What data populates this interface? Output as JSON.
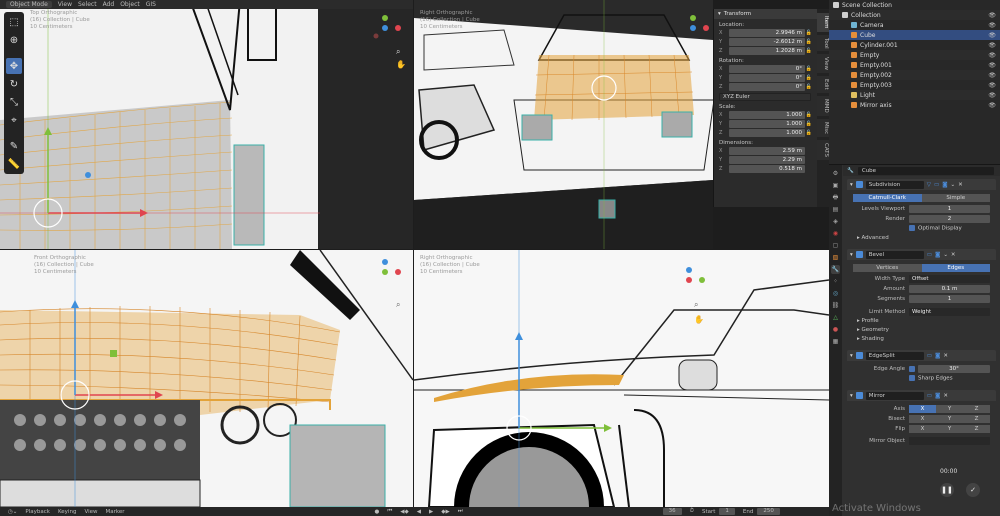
{
  "top_left": {
    "mode_label": "Object Mode",
    "menus": [
      "View",
      "Select",
      "Add",
      "Object",
      "GIS"
    ],
    "info": [
      "Top Orthographic",
      "(16) Collection | Cube",
      "10 Centimeters"
    ]
  },
  "top_right": {
    "info": [
      "Right Orthographic",
      "(16) Collection | Cube",
      "10 Centimeters"
    ]
  },
  "bottom_left": {
    "info": [
      "Front Orthographic",
      "(16) Collection | Cube",
      "10 Centimeters"
    ]
  },
  "bottom_right": {
    "info": [
      "Right Orthographic",
      "(16) Collection | Cube",
      "10 Centimeters"
    ]
  },
  "npanel": {
    "title": "Transform",
    "location_label": "Location:",
    "location": [
      {
        "axis": "X",
        "value": "2.9946 m"
      },
      {
        "axis": "Y",
        "value": "-2.6012 m"
      },
      {
        "axis": "Z",
        "value": "1.2028 m"
      }
    ],
    "rotation_label": "Rotation:",
    "rotation": [
      {
        "axis": "X",
        "value": "0°"
      },
      {
        "axis": "Y",
        "value": "0°"
      },
      {
        "axis": "Z",
        "value": "0°"
      }
    ],
    "rotation_mode": "XYZ Euler",
    "scale_label": "Scale:",
    "scale": [
      {
        "axis": "X",
        "value": "1.000"
      },
      {
        "axis": "Y",
        "value": "1.000"
      },
      {
        "axis": "Z",
        "value": "1.000"
      }
    ],
    "dimensions_label": "Dimensions:",
    "dimensions": [
      {
        "axis": "X",
        "value": "2.59 m"
      },
      {
        "axis": "Y",
        "value": "2.29 m"
      },
      {
        "axis": "Z",
        "value": "0.518 m"
      }
    ],
    "tabs": [
      "Item",
      "Tool",
      "View",
      "Edit",
      "MMD",
      "Misc",
      "CATS"
    ]
  },
  "outliner": {
    "items": [
      {
        "name": "Scene Collection",
        "indent": 0,
        "color": "#d0d0d0"
      },
      {
        "name": "Collection",
        "indent": 1,
        "color": "#d0d0d0"
      },
      {
        "name": "Camera",
        "indent": 2,
        "color": "#6fb3d2"
      },
      {
        "name": "Cube",
        "indent": 2,
        "color": "#e58e3b",
        "selected": true
      },
      {
        "name": "Cylinder.001",
        "indent": 2,
        "color": "#e58e3b"
      },
      {
        "name": "Empty",
        "indent": 2,
        "color": "#e58e3b"
      },
      {
        "name": "Empty.001",
        "indent": 2,
        "color": "#e58e3b"
      },
      {
        "name": "Empty.002",
        "indent": 2,
        "color": "#e58e3b"
      },
      {
        "name": "Empty.003",
        "indent": 2,
        "color": "#e58e3b"
      },
      {
        "name": "Light",
        "indent": 2,
        "color": "#e0c060"
      },
      {
        "name": "Mirror axis",
        "indent": 2,
        "color": "#e58e3b"
      }
    ]
  },
  "properties": {
    "object_name": "Cube",
    "subdivision": {
      "name": "Subdivision",
      "mode_a": "Catmull-Clark",
      "mode_b": "Simple",
      "levels_label": "Levels Viewport",
      "levels": "1",
      "render_label": "Render",
      "render": "2",
      "optimal": "Optimal Display",
      "advanced": "Advanced"
    },
    "bevel": {
      "name": "Bevel",
      "tab_a": "Vertices",
      "tab_b": "Edges",
      "width_type_label": "Width Type",
      "width_type": "Offset",
      "amount_label": "Amount",
      "amount": "0.1 m",
      "segments_label": "Segments",
      "segments": "1",
      "limit_label": "Limit Method",
      "limit": "Weight",
      "profile": "Profile",
      "geometry": "Geometry",
      "shading": "Shading"
    },
    "edgesplit": {
      "name": "EdgeSplit",
      "angle_label": "Edge Angle",
      "angle": "30°",
      "sharp": "Sharp Edges"
    },
    "mirror": {
      "name": "Mirror",
      "axis_label": "Axis",
      "bisect_label": "Bisect",
      "flip_label": "Flip",
      "axes": [
        "X",
        "Y",
        "Z"
      ],
      "mirror_object": "Mirror Object"
    }
  },
  "timeline": {
    "items": [
      "Playback",
      "Keying",
      "View",
      "Marker"
    ],
    "current_frame": "36",
    "start_label": "Start",
    "start": "1",
    "end_label": "End",
    "end": "250"
  },
  "overlay": {
    "watermark": "Activate Windows",
    "timer": "00:00"
  },
  "colors": {
    "accent": "#4772b3",
    "mesh_orange": "#e3a33a",
    "axis_x": "#e0454f",
    "axis_y": "#7fbf3a",
    "axis_z": "#3f8fdc"
  }
}
